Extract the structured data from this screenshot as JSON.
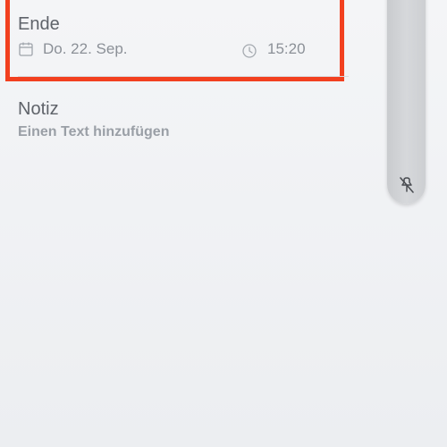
{
  "end": {
    "label": "Ende",
    "date": "Do. 22. Sep.",
    "time": "15:20",
    "date_icon": "calendar-icon",
    "time_icon": "clock-icon"
  },
  "note": {
    "label": "Notiz",
    "placeholder": "Einen Text hinzufügen"
  },
  "side_panel": {
    "icon": "pin-off-icon"
  },
  "colors": {
    "highlight": "#f2401f",
    "label": "#5f636a",
    "muted": "#8b9097"
  }
}
